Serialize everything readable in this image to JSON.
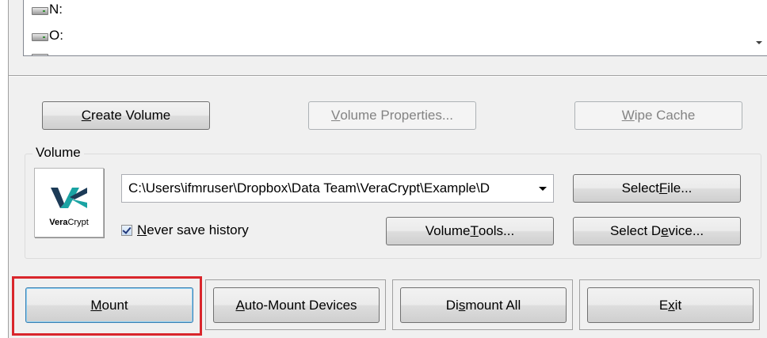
{
  "drives": [
    {
      "letter": "N:"
    },
    {
      "letter": "O:"
    }
  ],
  "toolbar": {
    "create_volume": {
      "label_pre": "",
      "accel": "C",
      "label_post": "reate Volume"
    },
    "volume_properties": {
      "label_pre": "",
      "accel": "V",
      "label_post": "olume Properties..."
    },
    "wipe_cache": {
      "label_pre": "",
      "accel": "W",
      "label_post": "ipe Cache"
    }
  },
  "volume": {
    "group_label": "Volume",
    "logo_text_bold": "Vera",
    "logo_text_rest": "Crypt",
    "path": "C:\\Users\\ifmruser\\Dropbox\\Data Team\\VeraCrypt\\Example\\D",
    "never_save_history": {
      "label_pre": "",
      "accel": "N",
      "label_post": "ever save history",
      "checked": true
    },
    "select_file": {
      "label_pre": "Select ",
      "accel": "F",
      "label_post": "ile..."
    },
    "volume_tools": {
      "label_pre": "Volume ",
      "accel": "T",
      "label_post": "ools..."
    },
    "select_device": {
      "label_pre": "Select D",
      "accel": "e",
      "label_post": "vice..."
    }
  },
  "actions": {
    "mount": {
      "label_pre": "",
      "accel": "M",
      "label_post": "ount"
    },
    "auto_mount": {
      "label_pre": "",
      "accel": "A",
      "label_post": "uto-Mount Devices"
    },
    "dismount_all": {
      "label_pre": "Di",
      "accel": "s",
      "label_post": "mount All"
    },
    "exit": {
      "label_pre": "E",
      "accel": "x",
      "label_post": "it"
    }
  },
  "colors": {
    "highlight": "#d9262c",
    "logo_accent": "#1aa3a3",
    "logo_dark": "#1c3b57"
  }
}
